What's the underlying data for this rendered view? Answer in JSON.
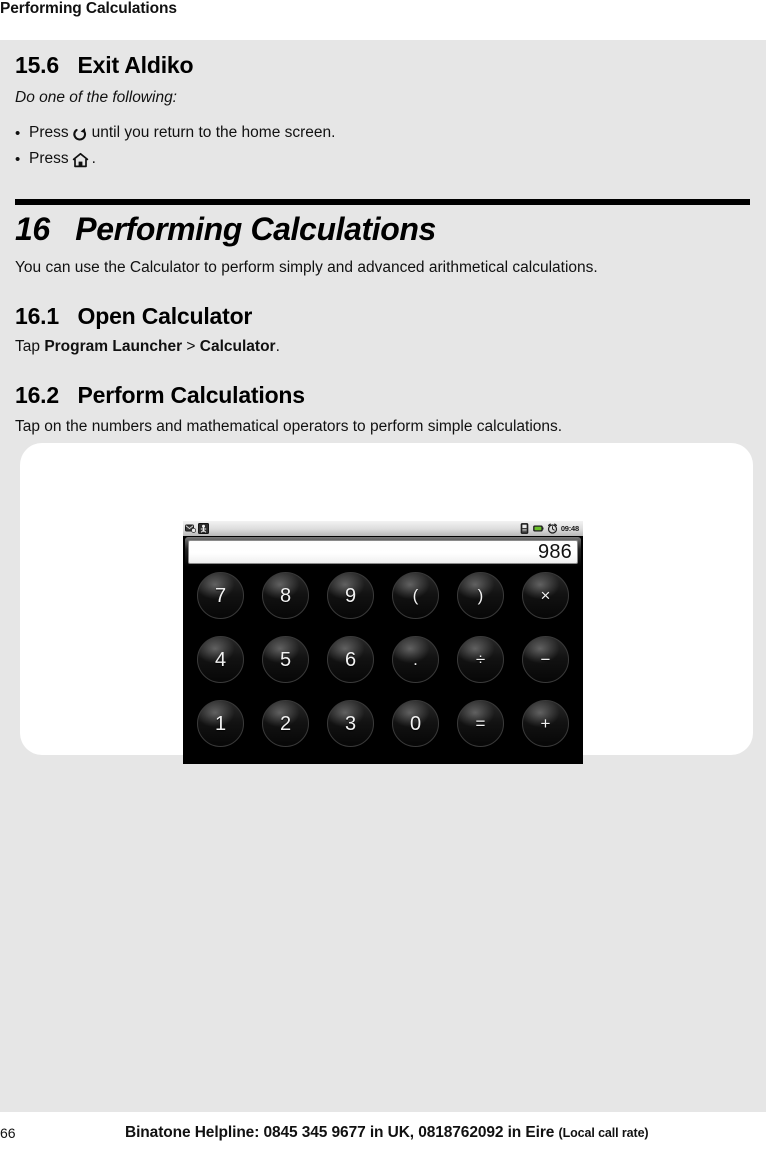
{
  "running_header": {
    "title": "Performing Calculations"
  },
  "section_15_6": {
    "number": "15.6",
    "title": "Exit Aldiko",
    "heading": "15.6   Exit Aldiko",
    "intro": "Do one of the following:",
    "bullets": [
      {
        "bullet": "•",
        "text_before": "Press",
        "icon": "back-return-arrow-icon",
        "text_after": "until you return to the home screen."
      },
      {
        "bullet": "•",
        "text_before": "Press",
        "icon": "home-icon",
        "text_after": "."
      }
    ]
  },
  "chapter_16": {
    "number": "16",
    "title": "Performing Calculations",
    "heading": "16   Performing Calculations",
    "intro": "You can use the Calculator to perform simply and advanced arithmetical calculations."
  },
  "section_16_1": {
    "number": "16.1",
    "title": "Open Calculator",
    "heading": "16.1   Open Calculator",
    "body_prefix": "Tap ",
    "body_bold_1": "Program Launcher",
    "body_separator": " > ",
    "body_bold_2": "Calculator",
    "body_suffix": "."
  },
  "section_16_2": {
    "number": "16.2",
    "title": "Perform Calculations",
    "heading": "16.2   Perform Calculations",
    "body": "Tap on the numbers and mathematical operators to perform simple calculations."
  },
  "figure": {
    "phone_screenshot": {
      "status_bar": {
        "left_icons": [
          "message-icon",
          "usb-debug-icon"
        ],
        "right_icons": [
          "sim-card-icon",
          "battery-icon",
          "alarm-clock-icon"
        ],
        "clock": "09:48",
        "battery_color": "#6abf2a"
      },
      "calculator": {
        "display_value": "986",
        "keypad_rows": [
          [
            {
              "label": "7",
              "name": "key-7",
              "type": "digit"
            },
            {
              "label": "8",
              "name": "key-8",
              "type": "digit"
            },
            {
              "label": "9",
              "name": "key-9",
              "type": "digit"
            },
            {
              "label": "(",
              "name": "key-open-paren",
              "type": "op"
            },
            {
              "label": ")",
              "name": "key-close-paren",
              "type": "op"
            },
            {
              "label": "×",
              "name": "key-multiply",
              "type": "op"
            }
          ],
          [
            {
              "label": "4",
              "name": "key-4",
              "type": "digit"
            },
            {
              "label": "5",
              "name": "key-5",
              "type": "digit"
            },
            {
              "label": "6",
              "name": "key-6",
              "type": "digit"
            },
            {
              "label": ".",
              "name": "key-decimal-point",
              "type": "op"
            },
            {
              "label": "÷",
              "name": "key-divide",
              "type": "op"
            },
            {
              "label": "−",
              "name": "key-minus",
              "type": "op"
            }
          ],
          [
            {
              "label": "1",
              "name": "key-1",
              "type": "digit"
            },
            {
              "label": "2",
              "name": "key-2",
              "type": "digit"
            },
            {
              "label": "3",
              "name": "key-3",
              "type": "digit"
            },
            {
              "label": "0",
              "name": "key-0",
              "type": "digit"
            },
            {
              "label": "=",
              "name": "key-equals",
              "type": "op"
            },
            {
              "label": "+",
              "name": "key-plus",
              "type": "op"
            }
          ]
        ]
      }
    }
  },
  "footer": {
    "page_number": "66",
    "helpline": "Binatone Helpline: 0845 345 9677 in UK, 0818762092 in Eire ",
    "rate_note": "(Local call rate)"
  }
}
